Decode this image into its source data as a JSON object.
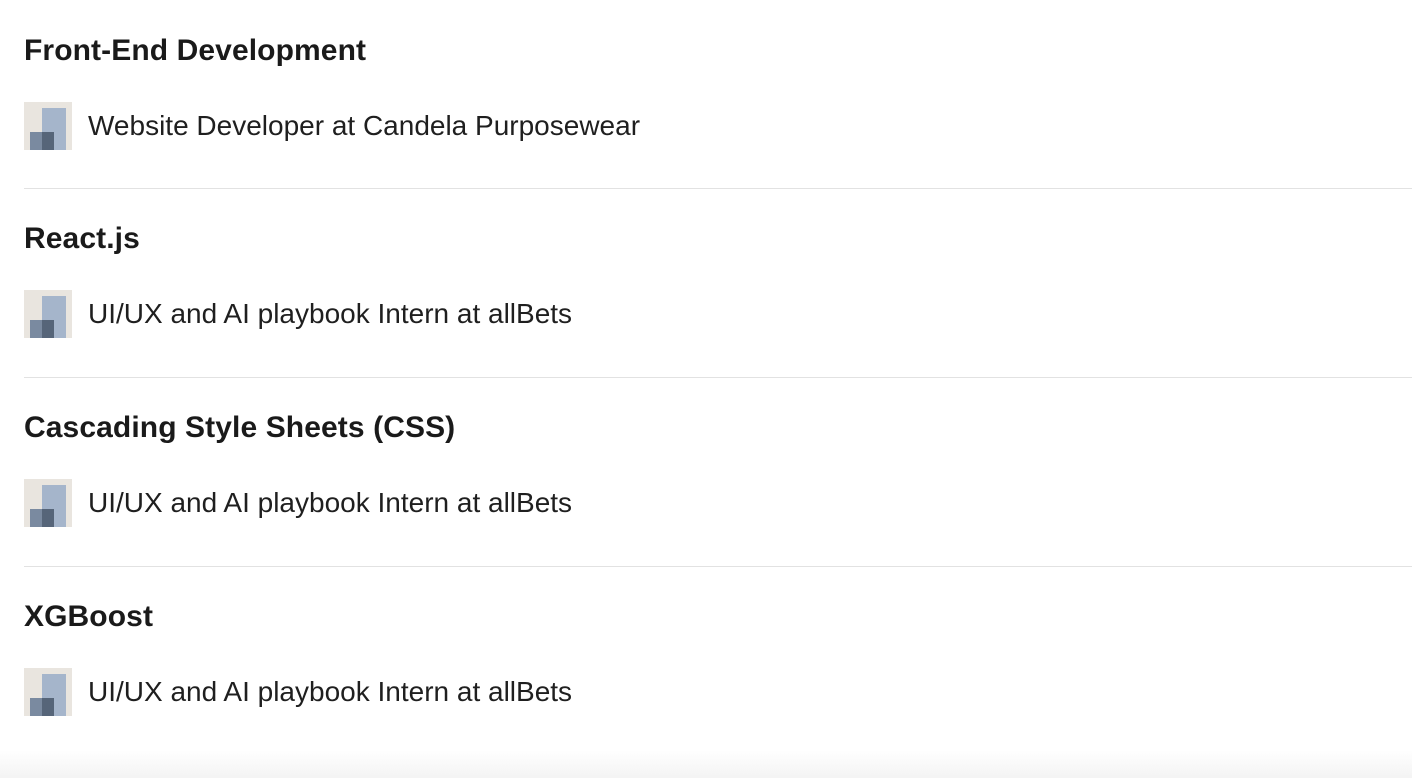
{
  "skills": [
    {
      "title": "Front-End Development",
      "endorsement": "Website Developer at Candela Purposewear",
      "logo_icon": "company-logo-icon"
    },
    {
      "title": "React.js",
      "endorsement": "UI/UX and AI playbook Intern at allBets",
      "logo_icon": "company-logo-icon"
    },
    {
      "title": "Cascading Style Sheets (CSS)",
      "endorsement": "UI/UX and AI playbook Intern at allBets",
      "logo_icon": "company-logo-icon"
    },
    {
      "title": "XGBoost",
      "endorsement": "UI/UX and AI playbook Intern at allBets",
      "logo_icon": "company-logo-icon"
    }
  ],
  "colors": {
    "text": "#1a1a1a",
    "divider": "#e2e2e2",
    "logo_background": "#e9e5df",
    "logo_light": "#a5b5cb",
    "logo_dark": "#566579"
  }
}
